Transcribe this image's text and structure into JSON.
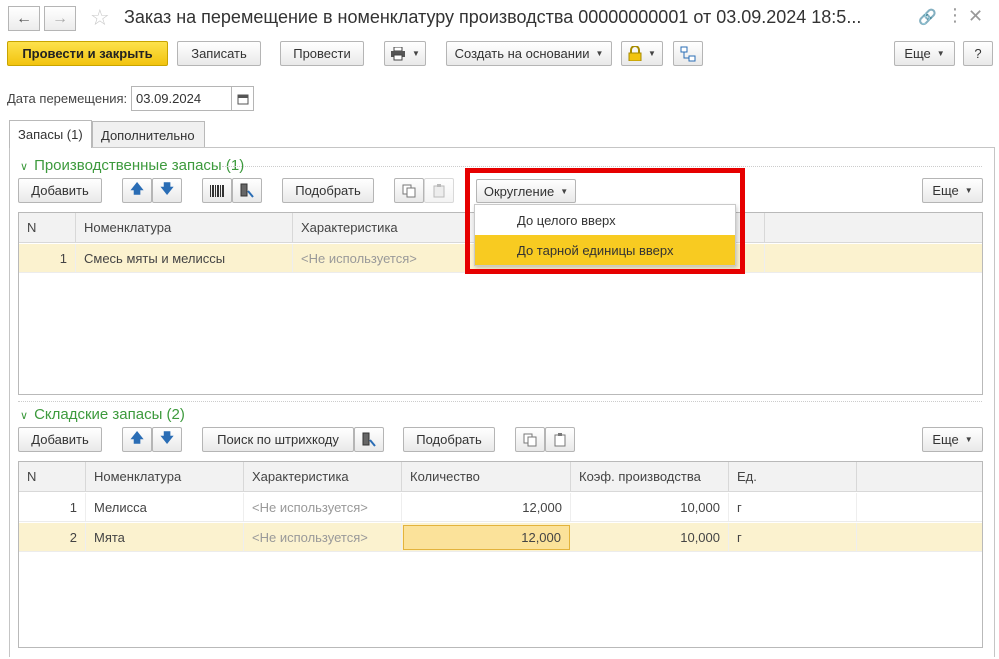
{
  "window": {
    "title": "Заказ на перемещение в номенклатуру производства 00000000001 от 03.09.2024 18:5..."
  },
  "toolbar": {
    "post_close": "Провести и закрыть",
    "save": "Записать",
    "post": "Провести",
    "create_based": "Создать на основании",
    "more": "Еще",
    "help": "?"
  },
  "form": {
    "date_label": "Дата перемещения:",
    "date_value": "03.09.2024"
  },
  "tabs": [
    "Запасы (1)",
    "Дополнительно"
  ],
  "production": {
    "title": "Производственные запасы (1)",
    "add": "Добавить",
    "pick": "Подобрать",
    "rounding": "Округление",
    "more": "Еще",
    "columns": [
      "N",
      "Номенклатура",
      "Характеристика"
    ],
    "rows": [
      {
        "n": "1",
        "name": "Смесь мяты и мелиссы",
        "char": "<Не используется>"
      }
    ]
  },
  "rounding_menu": {
    "items": [
      "До целого вверх",
      "До тарной единицы вверх"
    ],
    "active_index": 1
  },
  "warehouse": {
    "title": "Складские запасы (2)",
    "add": "Добавить",
    "barcode": "Поиск по штрихкоду",
    "pick": "Подобрать",
    "more": "Еще",
    "columns": [
      "N",
      "Номенклатура",
      "Характеристика",
      "Количество",
      "Коэф. производства",
      "Ед."
    ],
    "rows": [
      {
        "n": "1",
        "name": "Мелисса",
        "char": "<Не используется>",
        "qty": "12,000",
        "coef": "10,000",
        "unit": "г"
      },
      {
        "n": "2",
        "name": "Мята",
        "char": "<Не используется>",
        "qty": "12,000",
        "coef": "10,000",
        "unit": "г"
      }
    ]
  },
  "colors": {
    "accent_yellow": "#f2c30f",
    "section_green": "#3d9a3d",
    "highlight_red": "#e60000",
    "selected_row": "#fbf2cf"
  }
}
